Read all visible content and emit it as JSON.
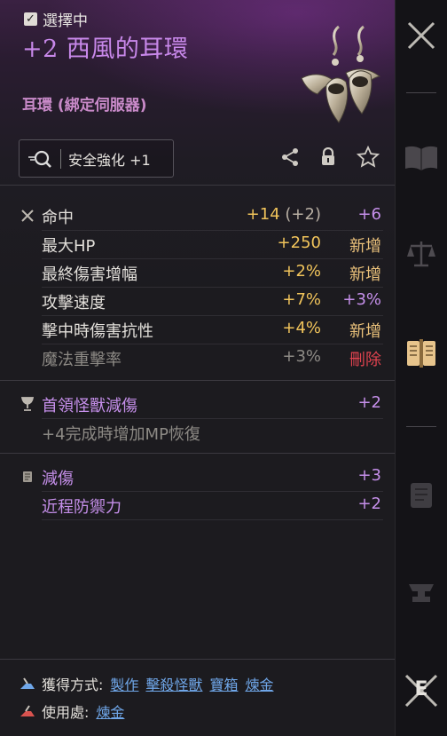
{
  "header": {
    "selected_label": "選擇中",
    "title": "+2 西風的耳環",
    "subtitle": "耳環 (綁定伺服器)"
  },
  "enhance": {
    "label": "安全強化 +1"
  },
  "stats": [
    {
      "name": "命中",
      "value": "+14",
      "paren": "(+2)",
      "change": "+6",
      "change_color": "purple",
      "dim": false
    },
    {
      "name": "最大HP",
      "value": "+250",
      "paren": "",
      "change": "新增",
      "change_color": "yellow",
      "dim": false
    },
    {
      "name": "最終傷害增幅",
      "value": "+2%",
      "paren": "",
      "change": "新增",
      "change_color": "yellow",
      "dim": false
    },
    {
      "name": "攻擊速度",
      "value": "+7%",
      "paren": "",
      "change": "+3%",
      "change_color": "purple",
      "dim": false
    },
    {
      "name": "擊中時傷害抗性",
      "value": "+4%",
      "paren": "",
      "change": "新增",
      "change_color": "yellow",
      "dim": false
    },
    {
      "name": "魔法重擊率",
      "value": "+3%",
      "paren": "",
      "change": "刪除",
      "change_color": "red",
      "dim": true
    }
  ],
  "set_bonus_1": {
    "name": "首領怪獸減傷",
    "value": "+2",
    "desc": "+4完成時增加MP恢復"
  },
  "set_bonus_2": [
    {
      "name": "減傷",
      "value": "+3"
    },
    {
      "name": "近程防禦力",
      "value": "+2"
    }
  ],
  "footer": {
    "obtain_label": "獲得方式:",
    "obtain_links": [
      "製作",
      "擊殺怪獸",
      "寶箱",
      "煉金"
    ],
    "use_label": "使用處:",
    "use_links": [
      "煉金"
    ]
  },
  "sidebar": {
    "hotkey_label": "E"
  },
  "colors": {
    "title_purple": "#c888ea",
    "value_gold": "#f1c45b",
    "added_yellow": "#e9c07a",
    "removed_red": "#e0434f",
    "link_blue": "#6fa6e8"
  }
}
